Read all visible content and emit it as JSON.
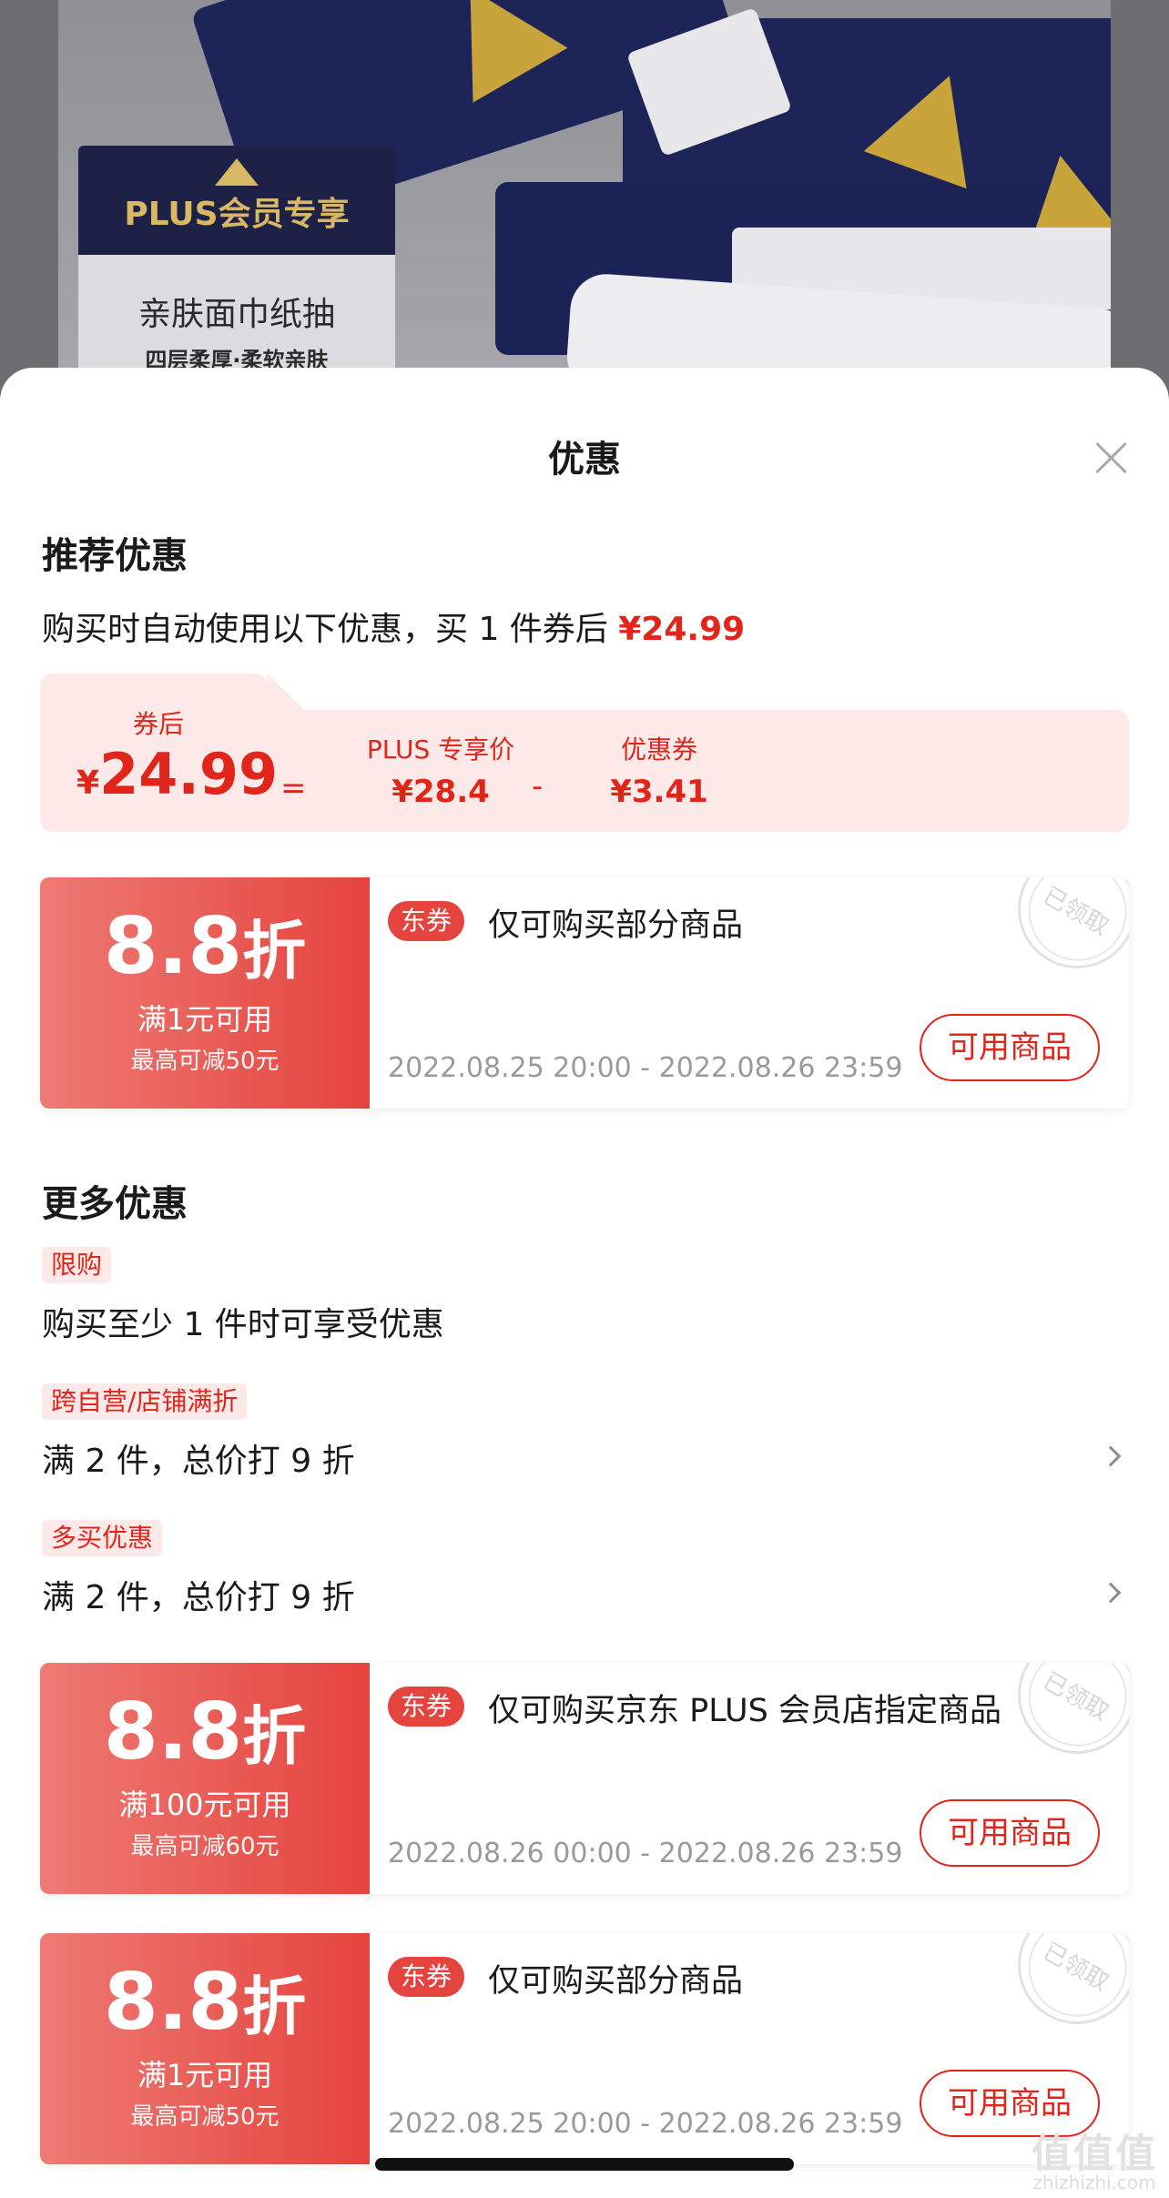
{
  "product_image": {
    "plus_tag": "PLUS会员专享",
    "line1": "亲肤面巾纸抽",
    "line2": "四层柔厚·柔软亲肤"
  },
  "sheet": {
    "title": "优惠",
    "close_icon": "close-icon"
  },
  "recommended": {
    "title": "推荐优惠",
    "desc_prefix": "购买时自动使用以下优惠，买 1 件券后 ",
    "desc_price": "¥24.99",
    "calc": {
      "after_label": "券后",
      "after_yen": "¥",
      "after_value": "24.99",
      "equals": "=",
      "plus_label": "PLUS 专享价",
      "plus_value": "¥28.4",
      "minus": "-",
      "coupon_label": "优惠券",
      "coupon_value": "¥3.41"
    },
    "coupon": {
      "discount": "8.8",
      "unit": "折",
      "condition": "满1元可用",
      "cap": "最高可减50元",
      "badge": "东券",
      "name": "仅可购买部分商品",
      "date": "2022.08.25 20:00 - 2022.08.26 23:59",
      "button": "可用商品",
      "stamp": "已领取"
    }
  },
  "more": {
    "title": "更多优惠",
    "items": [
      {
        "tag": "限购",
        "text": "购买至少 1 件时可享受优惠"
      },
      {
        "tag": "跨自营/店铺满折",
        "text": "满 2 件，总价打 9 折"
      },
      {
        "tag": "多买优惠",
        "text": "满 2 件，总价打 9 折"
      }
    ],
    "coupons": [
      {
        "discount": "8.8",
        "unit": "折",
        "condition": "满100元可用",
        "cap": "最高可减60元",
        "badge": "东券",
        "name": "仅可购买京东 PLUS 会员店指定商品",
        "date": "2022.08.26 00:00 - 2022.08.26 23:59",
        "button": "可用商品",
        "stamp": "已领取"
      },
      {
        "discount": "8.8",
        "unit": "折",
        "condition": "满1元可用",
        "cap": "最高可减50元",
        "badge": "东券",
        "name": "仅可购买部分商品",
        "date": "2022.08.25 20:00 - 2022.08.26 23:59",
        "button": "可用商品",
        "stamp": "已领取"
      }
    ]
  },
  "watermark": {
    "main": "值值值",
    "sub": "zhizhizhi.com"
  },
  "colors": {
    "accent": "#e1251b",
    "coupon_bg": "#e5433d",
    "calc_bg": "#fde9e8"
  }
}
